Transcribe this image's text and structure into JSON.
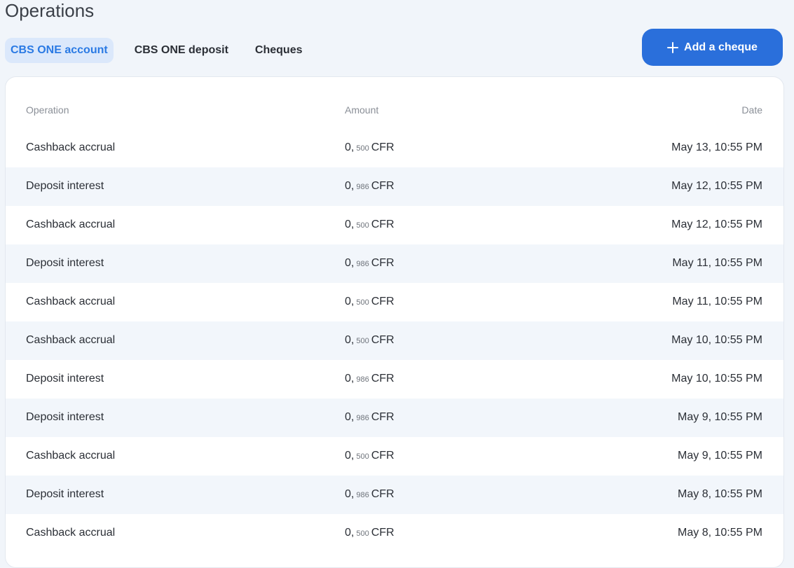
{
  "page": {
    "title": "Operations"
  },
  "tabs": [
    {
      "label": "CBS ONE account",
      "active": true
    },
    {
      "label": "CBS ONE deposit",
      "active": false
    },
    {
      "label": "Cheques",
      "active": false
    }
  ],
  "add_button": {
    "label": "Add a cheque",
    "icon": "plus-icon"
  },
  "table": {
    "headers": {
      "operation": "Operation",
      "amount": "Amount",
      "date": "Date"
    },
    "rows": [
      {
        "operation": "Cashback accrual",
        "amount_int": "0,",
        "amount_dec": "500",
        "currency": "CFR",
        "date": "May 13, 10:55 PM"
      },
      {
        "operation": "Deposit interest",
        "amount_int": "0,",
        "amount_dec": "986",
        "currency": "CFR",
        "date": "May 12, 10:55 PM"
      },
      {
        "operation": "Cashback accrual",
        "amount_int": "0,",
        "amount_dec": "500",
        "currency": "CFR",
        "date": "May 12, 10:55 PM"
      },
      {
        "operation": "Deposit interest",
        "amount_int": "0,",
        "amount_dec": "986",
        "currency": "CFR",
        "date": "May 11, 10:55 PM"
      },
      {
        "operation": "Cashback accrual",
        "amount_int": "0,",
        "amount_dec": "500",
        "currency": "CFR",
        "date": "May 11, 10:55 PM"
      },
      {
        "operation": "Cashback accrual",
        "amount_int": "0,",
        "amount_dec": "500",
        "currency": "CFR",
        "date": "May 10, 10:55 PM"
      },
      {
        "operation": "Deposit interest",
        "amount_int": "0,",
        "amount_dec": "986",
        "currency": "CFR",
        "date": "May 10, 10:55 PM"
      },
      {
        "operation": "Deposit interest",
        "amount_int": "0,",
        "amount_dec": "986",
        "currency": "CFR",
        "date": "May 9, 10:55 PM"
      },
      {
        "operation": "Cashback accrual",
        "amount_int": "0,",
        "amount_dec": "500",
        "currency": "CFR",
        "date": "May 9, 10:55 PM"
      },
      {
        "operation": "Deposit interest",
        "amount_int": "0,",
        "amount_dec": "986",
        "currency": "CFR",
        "date": "May 8, 10:55 PM"
      },
      {
        "operation": "Cashback accrual",
        "amount_int": "0,",
        "amount_dec": "500",
        "currency": "CFR",
        "date": "May 8, 10:55 PM"
      }
    ]
  },
  "colors": {
    "accent": "#2a6fdb",
    "active_tab_bg": "#dbe8fb",
    "active_tab_text": "#2a7ae4",
    "page_bg": "#f1f5fa"
  }
}
